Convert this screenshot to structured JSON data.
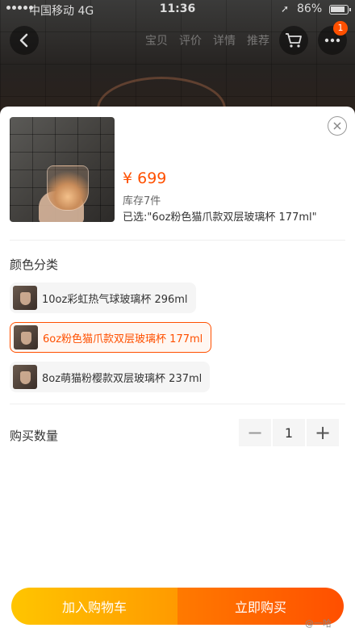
{
  "status_bar": {
    "carrier": "中国移动  4G",
    "time": "11:36",
    "battery": "86%"
  },
  "nav": {
    "dim_tabs": [
      "宝贝",
      "评价",
      "详情",
      "推荐"
    ],
    "cart_badge": "1"
  },
  "product": {
    "price": "¥ 699",
    "stock": "库存7件",
    "selected": "已选:\"6oz粉色猫爪款双层玻璃杯 177ml\""
  },
  "color_section": {
    "title": "颜色分类",
    "options": [
      {
        "label": "10oz彩虹热气球玻璃杯 296ml",
        "selected": false
      },
      {
        "label": "6oz粉色猫爪款双层玻璃杯 177ml",
        "selected": true
      },
      {
        "label": "8oz萌猫粉樱款双层玻璃杯 237ml",
        "selected": false
      }
    ]
  },
  "quantity": {
    "title": "购买数量",
    "minus": "−",
    "value": "1",
    "plus": "+"
  },
  "footer": {
    "add_to_cart": "加入购物车",
    "buy_now": "立即购买"
  },
  "watermark": "@一哈"
}
